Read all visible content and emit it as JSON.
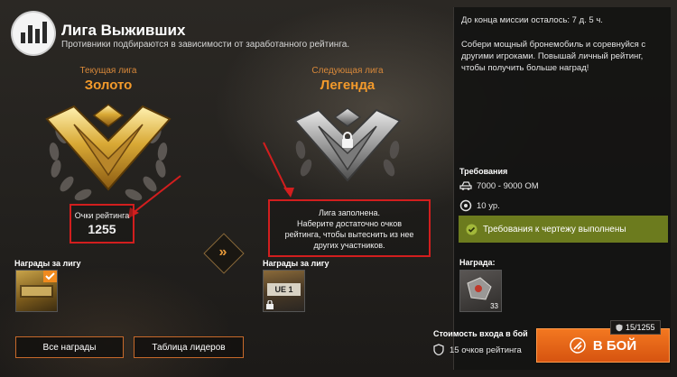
{
  "header": {
    "title": "Лига Выживших",
    "subtitle": "Противники подбираются в зависимости от заработанного рейтинга."
  },
  "current_league": {
    "label": "Текущая лига",
    "name": "Золото"
  },
  "next_league": {
    "label": "Следующая лига",
    "name": "Легенда"
  },
  "rating": {
    "label": "Очки рейтинга",
    "value": "1255"
  },
  "league_full_message": {
    "line1": "Лига заполнена.",
    "line2": "Наберите достаточно очков",
    "line3": "рейтинга, чтобы вытеснить из нее",
    "line4": "других участников."
  },
  "rewards": {
    "league_label": "Награды за лигу",
    "league_label_next": "Награды за лигу",
    "next_tile_caption": "UE 1",
    "reward_label": "Награда:",
    "reward_count": "33"
  },
  "buttons": {
    "all_rewards": "Все награды",
    "leaderboard": "Таблица лидеров",
    "battle": "В БОЙ"
  },
  "mission": {
    "time_left": "До конца миссии осталось: 7 д. 5 ч.",
    "description": "Собери мощный бронемобиль и соревнуйся с другими игроками. Повышай личный рейтинг, чтобы получить больше наград!"
  },
  "requirements": {
    "title": "Требования",
    "power": "7000 - 9000 ОМ",
    "level": "10 ур.",
    "blueprint_status": "Требования к чертежу выполнены"
  },
  "entry": {
    "cost_label": "Стоимость входа в бой",
    "cost_value": "15 очков рейтинга",
    "counter": "15/1255"
  },
  "colors": {
    "accent": "#f39a2b",
    "callout_red": "#d21e1e",
    "requirement_ok": "#6c7b1e",
    "battle_button": "#e8661a"
  }
}
